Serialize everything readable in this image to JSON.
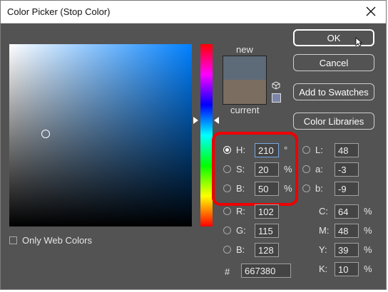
{
  "window": {
    "title": "Color Picker (Stop Color)"
  },
  "labels": {
    "new": "new",
    "current": "current",
    "web_colors": "Only Web Colors",
    "hash": "#"
  },
  "buttons": {
    "ok": "OK",
    "cancel": "Cancel",
    "add_swatches": "Add to Swatches",
    "libraries": "Color Libraries"
  },
  "fields": {
    "H": {
      "label": "H:",
      "value": "210",
      "unit": "°"
    },
    "S": {
      "label": "S:",
      "value": "20",
      "unit": "%"
    },
    "B": {
      "label": "B:",
      "value": "50",
      "unit": "%"
    },
    "R": {
      "label": "R:",
      "value": "102"
    },
    "G": {
      "label": "G:",
      "value": "115"
    },
    "B2": {
      "label": "B:",
      "value": "128"
    },
    "L": {
      "label": "L:",
      "value": "48"
    },
    "a": {
      "label": "a:",
      "value": "-3"
    },
    "b": {
      "label": "b:",
      "value": "-9"
    },
    "C": {
      "label": "C:",
      "value": "64",
      "unit": "%"
    },
    "M": {
      "label": "M:",
      "value": "48",
      "unit": "%"
    },
    "Y": {
      "label": "Y:",
      "value": "39",
      "unit": "%"
    },
    "K": {
      "label": "K:",
      "value": "10",
      "unit": "%"
    },
    "hex": {
      "value": "667380"
    }
  },
  "colors": {
    "new": "#5d6a78",
    "current": "#7b6d60",
    "highlight": "#ee0000"
  },
  "icons": {
    "close": "close-icon",
    "cube": "cube-icon",
    "cursor": "mouse-cursor-icon"
  }
}
